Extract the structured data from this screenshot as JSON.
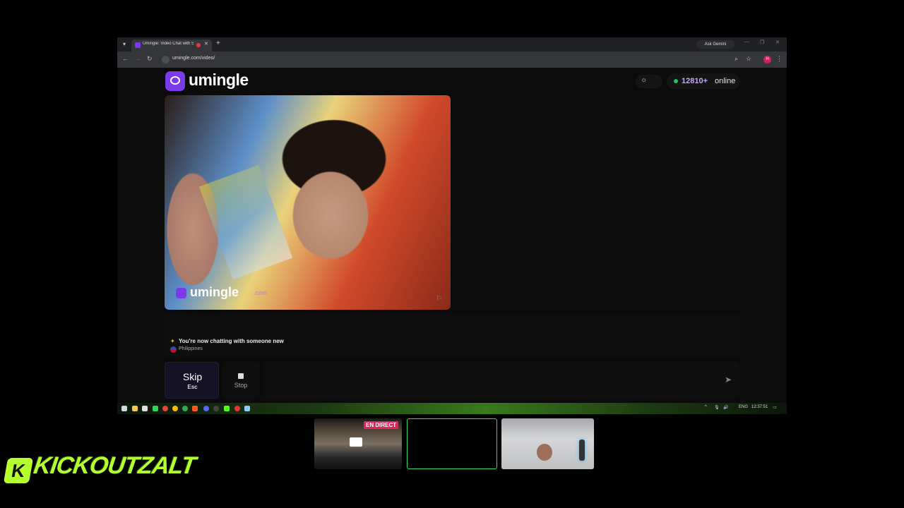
{
  "browser": {
    "tab_title": "Umingle: Video Chat with S",
    "ask_gemini": "Ask Gemini",
    "url": "umingle.com/video/",
    "profile_initial": "H"
  },
  "page": {
    "logo_text": "umingle",
    "online_count": "12810+",
    "online_label": "online",
    "watermark_text": "umingle",
    "watermark_domain": ".com",
    "chat_message": "You're now chatting with someone new",
    "country": "Philippines",
    "skip_label": "Skip",
    "skip_key": "Esc",
    "stop_label": "Stop",
    "message_placeholder": ""
  },
  "taskbar": {
    "lang": "ENG",
    "time": "12:37:51"
  },
  "overlay": {
    "live_badge": "EN DIRECT",
    "brand": "KICKOUTZALT",
    "brand_k": "K"
  },
  "colors": {
    "accent": "#7c3aed",
    "online_dot": "#22c55e",
    "brand_green": "#b5ff2e",
    "live_red": "#e0245e"
  },
  "icons": [
    "chevron-down-icon",
    "close-icon",
    "plus-icon",
    "back-icon",
    "forward-icon",
    "reload-icon",
    "zoom-icon",
    "star-icon",
    "menu-icon",
    "sun-icon",
    "flag-icon",
    "stop-icon",
    "send-icon"
  ]
}
